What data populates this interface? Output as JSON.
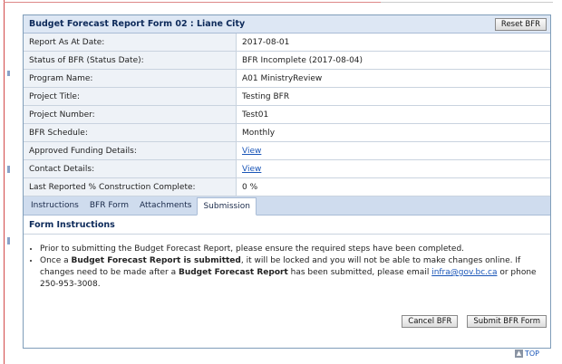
{
  "form": {
    "title": "Budget Forecast Report Form 02 : Liane City",
    "reset_label": "Reset BFR"
  },
  "rows": [
    {
      "label": "Report As At Date:",
      "value": "2017-08-01"
    },
    {
      "label": "Status of BFR (Status Date):",
      "value": "BFR Incomplete (2017-08-04)"
    },
    {
      "label": "Program Name:",
      "value": "A01 MinistryReview"
    },
    {
      "label": "Project Title:",
      "value": "Testing BFR"
    },
    {
      "label": "Project Number:",
      "value": "Test01"
    },
    {
      "label": "BFR Schedule:",
      "value": "Monthly"
    },
    {
      "label": "Approved Funding Details:",
      "value": "View"
    },
    {
      "label": "Contact Details:",
      "value": "View"
    },
    {
      "label": "Last Reported % Construction Complete:",
      "value": "0 %"
    }
  ],
  "tabs": [
    "Instructions",
    "BFR Form",
    "Attachments",
    "Submission"
  ],
  "active_tab": "Submission",
  "section": {
    "title": "Form Instructions",
    "bullet1": "Prior to submitting the Budget Forecast Report, please ensure the required steps have been completed.",
    "bullet2_part1": "Once a ",
    "bullet2_bold1": "Budget Forecast Report is submitted",
    "bullet2_part2": ", it will be locked and you will not be able to make changes online. If changes need to be made after a ",
    "bullet2_bold2": "Budget Forecast Report",
    "bullet2_part3": " has been submitted, please email ",
    "bullet2_email": "infra@gov.bc.ca",
    "bullet2_part4": " or phone 250-953-3008."
  },
  "buttons": {
    "cancel": "Cancel BFR",
    "submit": "Submit BFR Form"
  },
  "top_link": "TOP"
}
